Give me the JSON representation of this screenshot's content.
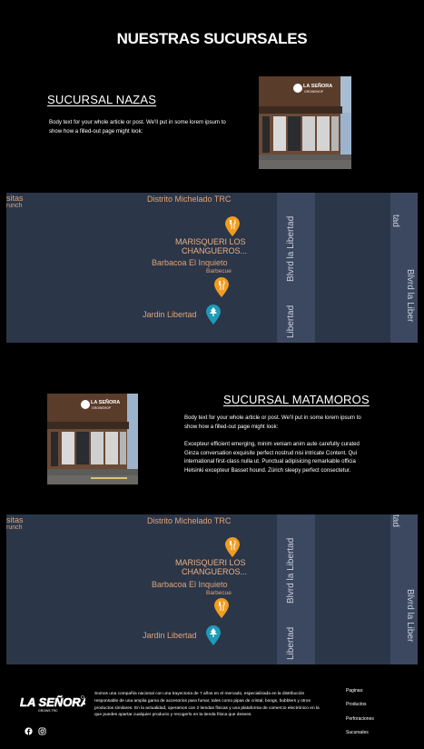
{
  "page": {
    "title": "NUESTRAS SUCURSALES"
  },
  "branches": [
    {
      "title": "SUCURSAL NAZAS",
      "body_paragraphs": [
        "Body text for your whole article or post. We'll put in some lorem ipsum to show how a filled-out page might look:"
      ]
    },
    {
      "title": "SUCURSAL MATAMOROS",
      "body_paragraphs": [
        "Body text for your whole article or post. We'll put in some lorem ipsum to show how a filled-out page might look:",
        "Excepteur efficient emerging, minim veniam anim aute carefully curated Ginza conversation exquisite perfect nostrud nisi intricate Content. Qui  international first-class nulla ut. Punctual adipisicing remarkable officia Helsinki excepteur Basset hound. Zürich sleepy perfect consectetur."
      ]
    }
  ],
  "map": {
    "labels": {
      "left_top": "sitas",
      "left_sub": "runch",
      "distrito": "Distrito Michelado TRC",
      "marisqueri_1": "MARISQUERI LOS",
      "marisqueri_2": "CHANGUEROS...",
      "barbacoa": "Barbacoa El Inquieto",
      "barbacoa_sub": "Barbecue",
      "jardin": "Jardin Libertad",
      "road_1a": "Libertad",
      "road_1b": "Blvrd la Libertad",
      "road_2a": "tad",
      "road_2b": "Blvrd la Liber"
    },
    "icons": [
      "restaurant-pin-icon",
      "restaurant-pin-icon",
      "park-pin-icon"
    ],
    "colors": {
      "background": "#2b3648",
      "road": "#3c4860",
      "orange_pin": "#f29c1f",
      "teal_pin": "#1e9bb8"
    }
  },
  "store_sign": {
    "line1": "LA SEÑORA",
    "line2": "GROWSHOP"
  },
  "footer": {
    "logo_line1": "LA SEÑORA",
    "logo_line2": "GROWS TRC",
    "description": "Somos una compañía nacional con una trayectoria de 7 años en el mercado, especializada en la distribución responsable de una amplia gama de accesorios para fumar, tales como pipas de cristal, bongs, bubblers y otros productos similares. En la actualidad, operamos con 2 tiendas físicas y una plataforma de comercio electrónico en la que puedes apartar cualquier producto y recogerlo en la tienda física que desees.",
    "pages_heading": "Paginas:",
    "links": [
      "Productos",
      "Perforaciones",
      "Sucursales"
    ],
    "social": [
      "facebook-icon",
      "instagram-icon"
    ]
  }
}
